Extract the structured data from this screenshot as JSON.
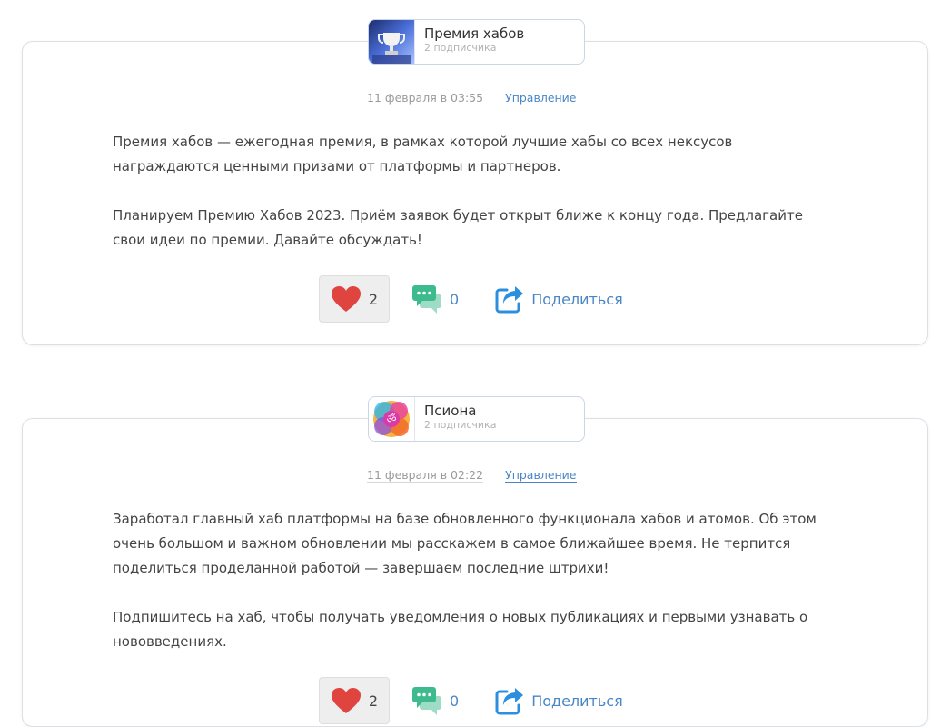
{
  "posts": [
    {
      "hub": {
        "name": "Премия хабов",
        "subscribers": "2 подписчика",
        "avatar_icon": "trophy-image"
      },
      "date": "11 февраля в 03:55",
      "manage_label": "Управление",
      "paragraphs": [
        "Премия хабов — ежегодная премия, в рамках которой лучшие хабы со всех нексусов награждаются ценными призами от платформы и партнеров.",
        "Планируем Премию Хабов 2023. Приём заявок будет открыт ближе к концу года. Предлагайте свои идеи по премии. Давайте обсуждать!"
      ],
      "likes": "2",
      "comments": "0",
      "share_label": "Поделиться"
    },
    {
      "hub": {
        "name": "Псиона",
        "subscribers": "2 подписчика",
        "avatar_icon": "colorful-om-image"
      },
      "date": "11 февраля в 02:22",
      "manage_label": "Управление",
      "paragraphs": [
        "Заработал главный хаб платформы на базе обновленного функционала хабов и атомов. Об этом очень большом и важном обновлении мы расскажем в самое ближайшее время. Не терпится поделиться проделанной работой — завершаем последние штрихи!",
        "Подпишитесь на хаб, чтобы получать уведомления о новых публикациях и первыми узнавать о нововведениях."
      ],
      "likes": "2",
      "comments": "0",
      "share_label": "Поделиться"
    }
  ],
  "colors": {
    "accent": "#4a86c5",
    "heart": "#e0443f",
    "comment": "#3dbb8e",
    "share": "#2b8fe0"
  }
}
